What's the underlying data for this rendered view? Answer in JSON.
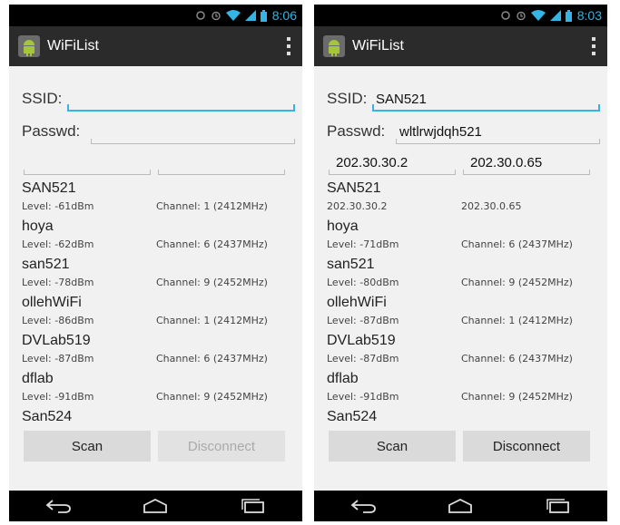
{
  "phones": [
    {
      "status": {
        "time": "8:06"
      },
      "action_bar": {
        "title": "WiFiList"
      },
      "ssid": {
        "label": "SSID:",
        "value": ""
      },
      "passwd": {
        "label": "Passwd:",
        "value": ""
      },
      "ip": {
        "left": "",
        "right": ""
      },
      "networks": [
        {
          "ssid": "SAN521",
          "level": "Level: -61dBm",
          "channel": "Channel: 1 (2412MHz)"
        },
        {
          "ssid": "hoya",
          "level": "Level: -62dBm",
          "channel": "Channel: 6 (2437MHz)"
        },
        {
          "ssid": "san521",
          "level": "Level: -78dBm",
          "channel": "Channel: 9 (2452MHz)"
        },
        {
          "ssid": "ollehWiFi",
          "level": "Level: -86dBm",
          "channel": "Channel: 1 (2412MHz)"
        },
        {
          "ssid": "DVLab519",
          "level": "Level: -87dBm",
          "channel": "Channel: 6 (2437MHz)"
        },
        {
          "ssid": "dflab",
          "level": "Level: -91dBm",
          "channel": "Channel: 9 (2452MHz)"
        },
        {
          "ssid": "San524",
          "level": "",
          "channel": ""
        }
      ],
      "buttons": {
        "scan": "Scan",
        "disconnect": "Disconnect"
      }
    },
    {
      "status": {
        "time": "8:03"
      },
      "action_bar": {
        "title": "WiFiList"
      },
      "ssid": {
        "label": "SSID:",
        "value": "SAN521"
      },
      "passwd": {
        "label": "Passwd:",
        "value": "wltlrwjdqh521"
      },
      "ip": {
        "left": "202.30.30.2",
        "right": "202.30.0.65"
      },
      "networks": [
        {
          "ssid": "SAN521",
          "level": "202.30.30.2",
          "channel": "202.30.0.65"
        },
        {
          "ssid": "hoya",
          "level": "Level: -71dBm",
          "channel": "Channel: 6 (2437MHz)"
        },
        {
          "ssid": "san521",
          "level": "Level: -80dBm",
          "channel": "Channel: 9 (2452MHz)"
        },
        {
          "ssid": "ollehWiFi",
          "level": "Level: -87dBm",
          "channel": "Channel: 1 (2412MHz)"
        },
        {
          "ssid": "DVLab519",
          "level": "Level: -87dBm",
          "channel": "Channel: 6 (2437MHz)"
        },
        {
          "ssid": "dflab",
          "level": "Level: -91dBm",
          "channel": "Channel: 9 (2452MHz)"
        },
        {
          "ssid": "San524",
          "level": "",
          "channel": ""
        }
      ],
      "buttons": {
        "scan": "Scan",
        "disconnect": "Disconnect"
      }
    }
  ],
  "colors": {
    "status_accent": "#33b5e5",
    "action_bar": "#2b2b2b",
    "screen_bg": "#f1f1f1",
    "button_bg": "#dadada",
    "disabled_text": "#aaaaaa"
  },
  "icons": {
    "status": [
      "sync-icon",
      "alarm-icon",
      "wifi-icon",
      "signal-icon",
      "battery-icon"
    ],
    "action_bar": [
      "android-app-icon",
      "overflow-menu-icon"
    ],
    "nav": [
      "back-icon",
      "home-icon",
      "recent-apps-icon"
    ]
  }
}
